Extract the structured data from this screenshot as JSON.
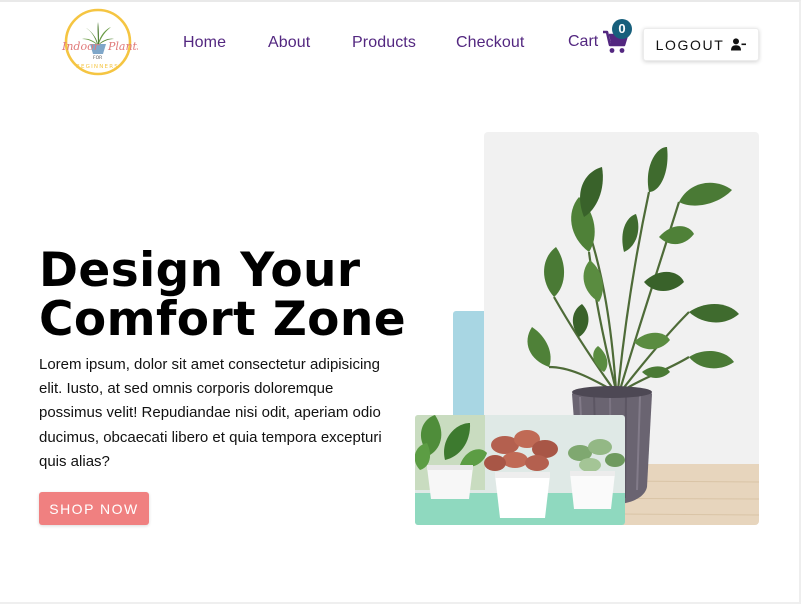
{
  "logo": {
    "line1": "Indoor",
    "line2": "Plants",
    "line3": "FOR",
    "line4": "BEGINNERS"
  },
  "nav": {
    "items": [
      {
        "label": "Home"
      },
      {
        "label": "About"
      },
      {
        "label": "Products"
      },
      {
        "label": "Checkout"
      }
    ],
    "cart_label": "Cart",
    "cart_count": "0",
    "logout_label": "LOGOUT"
  },
  "hero": {
    "title_line1": "Design Your",
    "title_line2": "Comfort Zone",
    "description": "Lorem ipsum, dolor sit amet consectetur adipisicing elit. Iusto, at sed omnis corporis doloremque possimus velit! Repudiandae nisi odit, aperiam odio ducimus, obcaecati libero et quia tempora excepturi quis alias?",
    "cta_label": "SHOP NOW"
  },
  "colors": {
    "nav_text": "#532780",
    "badge": "#175f7c",
    "cta": "#f08080",
    "accent": "#a8d6e3",
    "logo_ring": "#f5c542",
    "logo_text": "#e07a7a"
  },
  "icons": {
    "cart": "shopping-cart-icon",
    "logout": "user-minus-icon"
  }
}
